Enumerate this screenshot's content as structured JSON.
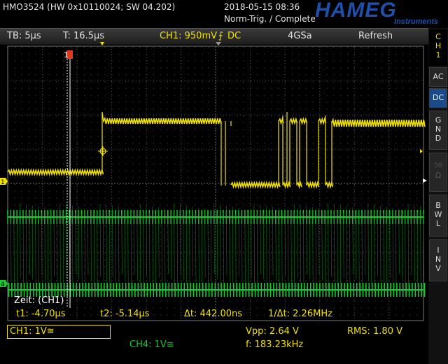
{
  "title": {
    "device": "HMO3524 (HW 0x10110024; SW 04.202)",
    "datetime": "2018-05-15 08:36",
    "mode": "Norm-Trig. / Complete",
    "brand": "HAMEG",
    "brand_sub": "Instruments"
  },
  "info": {
    "timebase": "TB: 5µs",
    "trigger_time": "T: 16.5µs",
    "ch1": "CH1: 950mV",
    "coupling": "DC",
    "sample_rate": "4GSa",
    "refresh": "Refresh"
  },
  "side": {
    "ch_label": [
      "C",
      "H",
      "1"
    ],
    "ac": "AC",
    "dc": "DC",
    "gnd": [
      "G",
      "N",
      "D"
    ],
    "fifty": [
      "50",
      "Ω"
    ],
    "bwl": [
      "B",
      "W",
      "L"
    ],
    "inv": [
      "I",
      "N",
      "V"
    ]
  },
  "markers": {
    "ch1": "1",
    "ch4": "4",
    "cursor": "1"
  },
  "measure": {
    "zeit": "Zeit: (CH1)",
    "t1": "t1: -4.70µs",
    "t2": "t2: -5.14µs",
    "dt": "Δt: 442.00ns",
    "inv_dt": "1/Δt: 2.26MHz"
  },
  "bottom": {
    "ch1_scale": "CH1: 1V≅",
    "ch4_scale": "CH4: 1V≅",
    "vpp": "Vpp: 2.64 V",
    "rms": "RMS: 1.80 V",
    "freq": "f: 183.23kHz"
  },
  "colors": {
    "ch1": "#f0e000",
    "ch4": "#19c832",
    "active": "#1a4a8a"
  }
}
